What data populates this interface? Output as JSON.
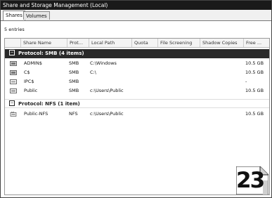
{
  "window": {
    "title": "Share and Storage Management (Local)"
  },
  "tabs": [
    {
      "label": "Shares",
      "active": true
    },
    {
      "label": "Volumes",
      "active": false
    }
  ],
  "entries_count": "5 entries",
  "columns": [
    "Share Name",
    "Prot...",
    "Local Path",
    "Quota",
    "File Screening",
    "Shadow Copies",
    "Free ..."
  ],
  "groups": [
    {
      "label": "Protocol: SMB (4 items)",
      "toggle": "▪",
      "rows": [
        {
          "name": "ADMIN$",
          "protocol": "SMB",
          "path": "C:\\Windows",
          "free": "10.5 GB"
        },
        {
          "name": "C$",
          "protocol": "SMB",
          "path": "C:\\",
          "free": "10.5 GB"
        },
        {
          "name": "IPC$",
          "protocol": "SMB",
          "path": "",
          "free": "-"
        },
        {
          "name": "Public",
          "protocol": "SMB",
          "path": "c:\\Users\\Public",
          "free": "10.5 GB"
        }
      ]
    },
    {
      "label": "Protocol: NFS (1 item)",
      "toggle": "−",
      "rows": [
        {
          "name": "Public-NFS",
          "protocol": "NFS",
          "path": "c:\\Users\\Public",
          "free": "10.5 GB"
        }
      ]
    }
  ],
  "badge": {
    "number": "23"
  },
  "colors": {
    "titlebar": "#1a1a1a",
    "group_header": "#2a2a2a"
  }
}
